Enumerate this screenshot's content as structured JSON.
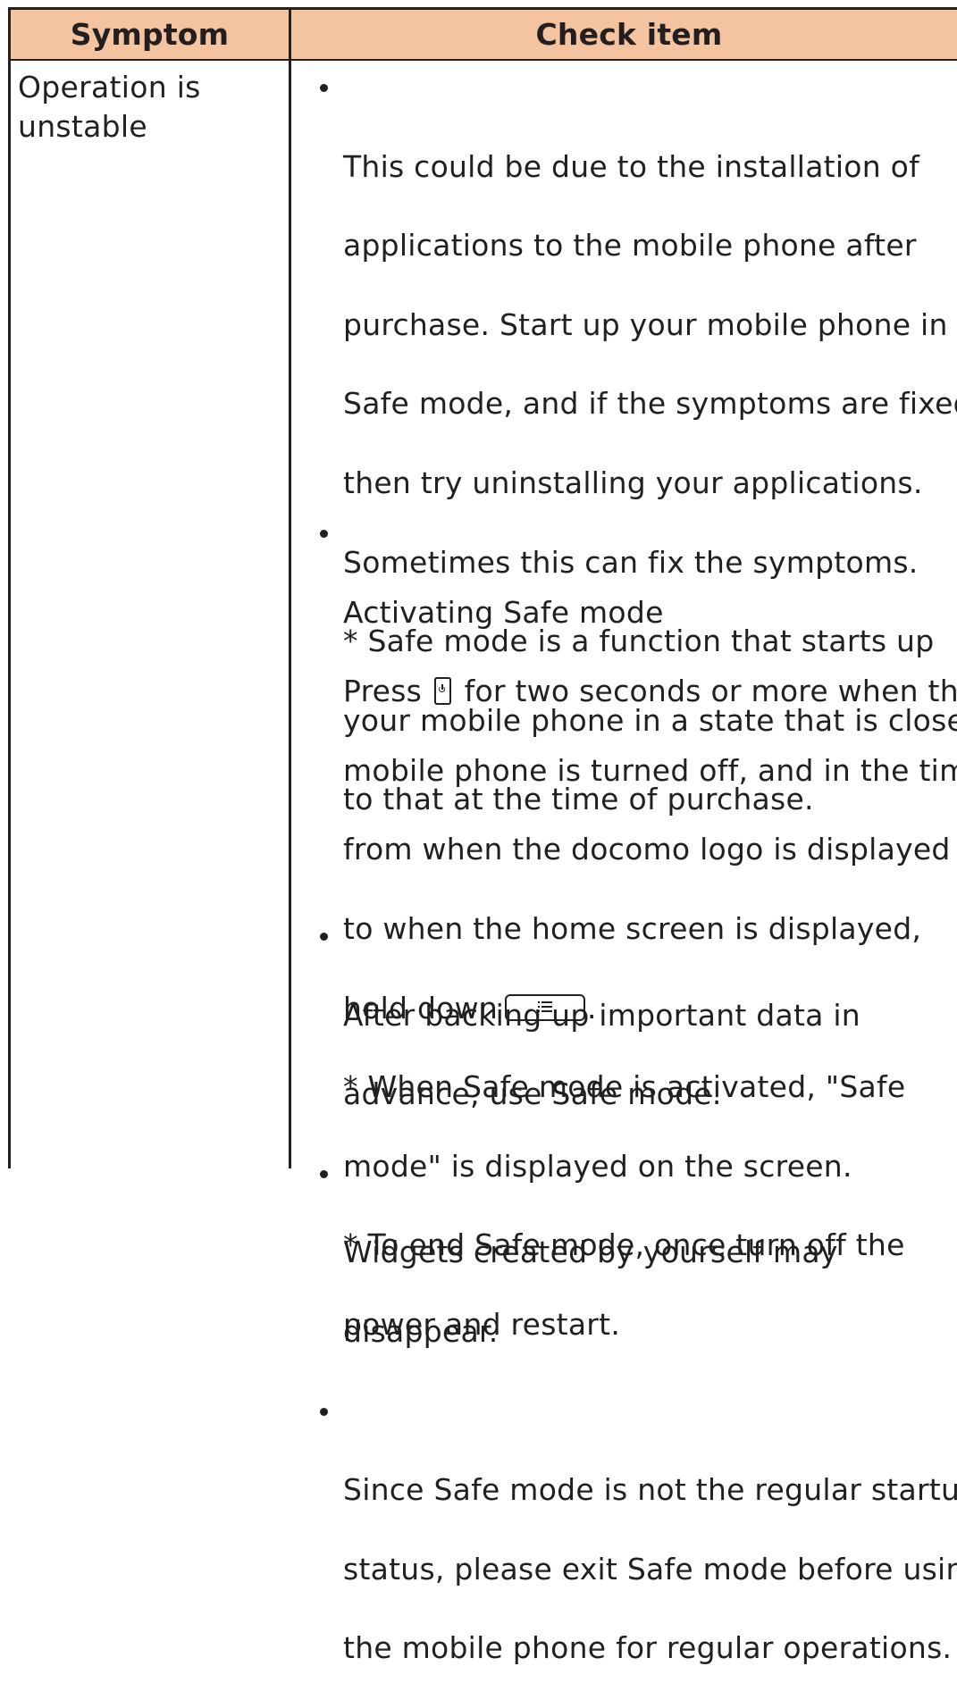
{
  "table": {
    "headers": {
      "symptom": "Symptom",
      "check_item": "Check item"
    },
    "rows": [
      {
        "symptom": "Operation is\nunstable",
        "check_groups": [
          {
            "items": [
              {
                "lines": [
                  "This could be due to the installation of",
                  "applications to the mobile phone after",
                  "purchase. Start up your mobile phone in",
                  "Safe mode, and if the symptoms are fixed,",
                  "then try uninstalling your applications.",
                  "Sometimes this can fix the symptoms.",
                  "* Safe mode is a function that starts up",
                  "your mobile phone in a state that is close",
                  "to that at the time of purchase."
                ]
              }
            ]
          },
          {
            "items": [
              {
                "title": "Activating Safe mode",
                "press_prefix": "Press",
                "press_suffix": "for two seconds or more when the",
                "lines": [
                  "mobile phone is turned off, and in the time",
                  "from when the docomo logo is displayed",
                  "to when the home screen is displayed,"
                ],
                "hold_prefix": "hold down",
                "hold_suffix": ".",
                "notes": [
                  "* When Safe mode is activated, \"Safe",
                  "mode\" is displayed on the screen.",
                  "* To end Safe mode, once turn off the",
                  "power and restart."
                ]
              }
            ]
          },
          {
            "items": [
              {
                "lines": [
                  "After backing up important data in",
                  "advance, use Safe mode."
                ]
              },
              {
                "lines": [
                  "Widgets created by yourself may",
                  "disappear."
                ]
              },
              {
                "lines": [
                  "Since Safe mode is not the regular startup",
                  "status, please exit Safe mode before using",
                  "the mobile phone for regular operations."
                ]
              }
            ]
          }
        ]
      }
    ]
  },
  "icons": {
    "power_key": "power-key-icon",
    "menu_key": "menu-key-icon"
  },
  "colors": {
    "header_background": "#f4c4a1",
    "border": "#231f20",
    "text": "#231f20"
  }
}
